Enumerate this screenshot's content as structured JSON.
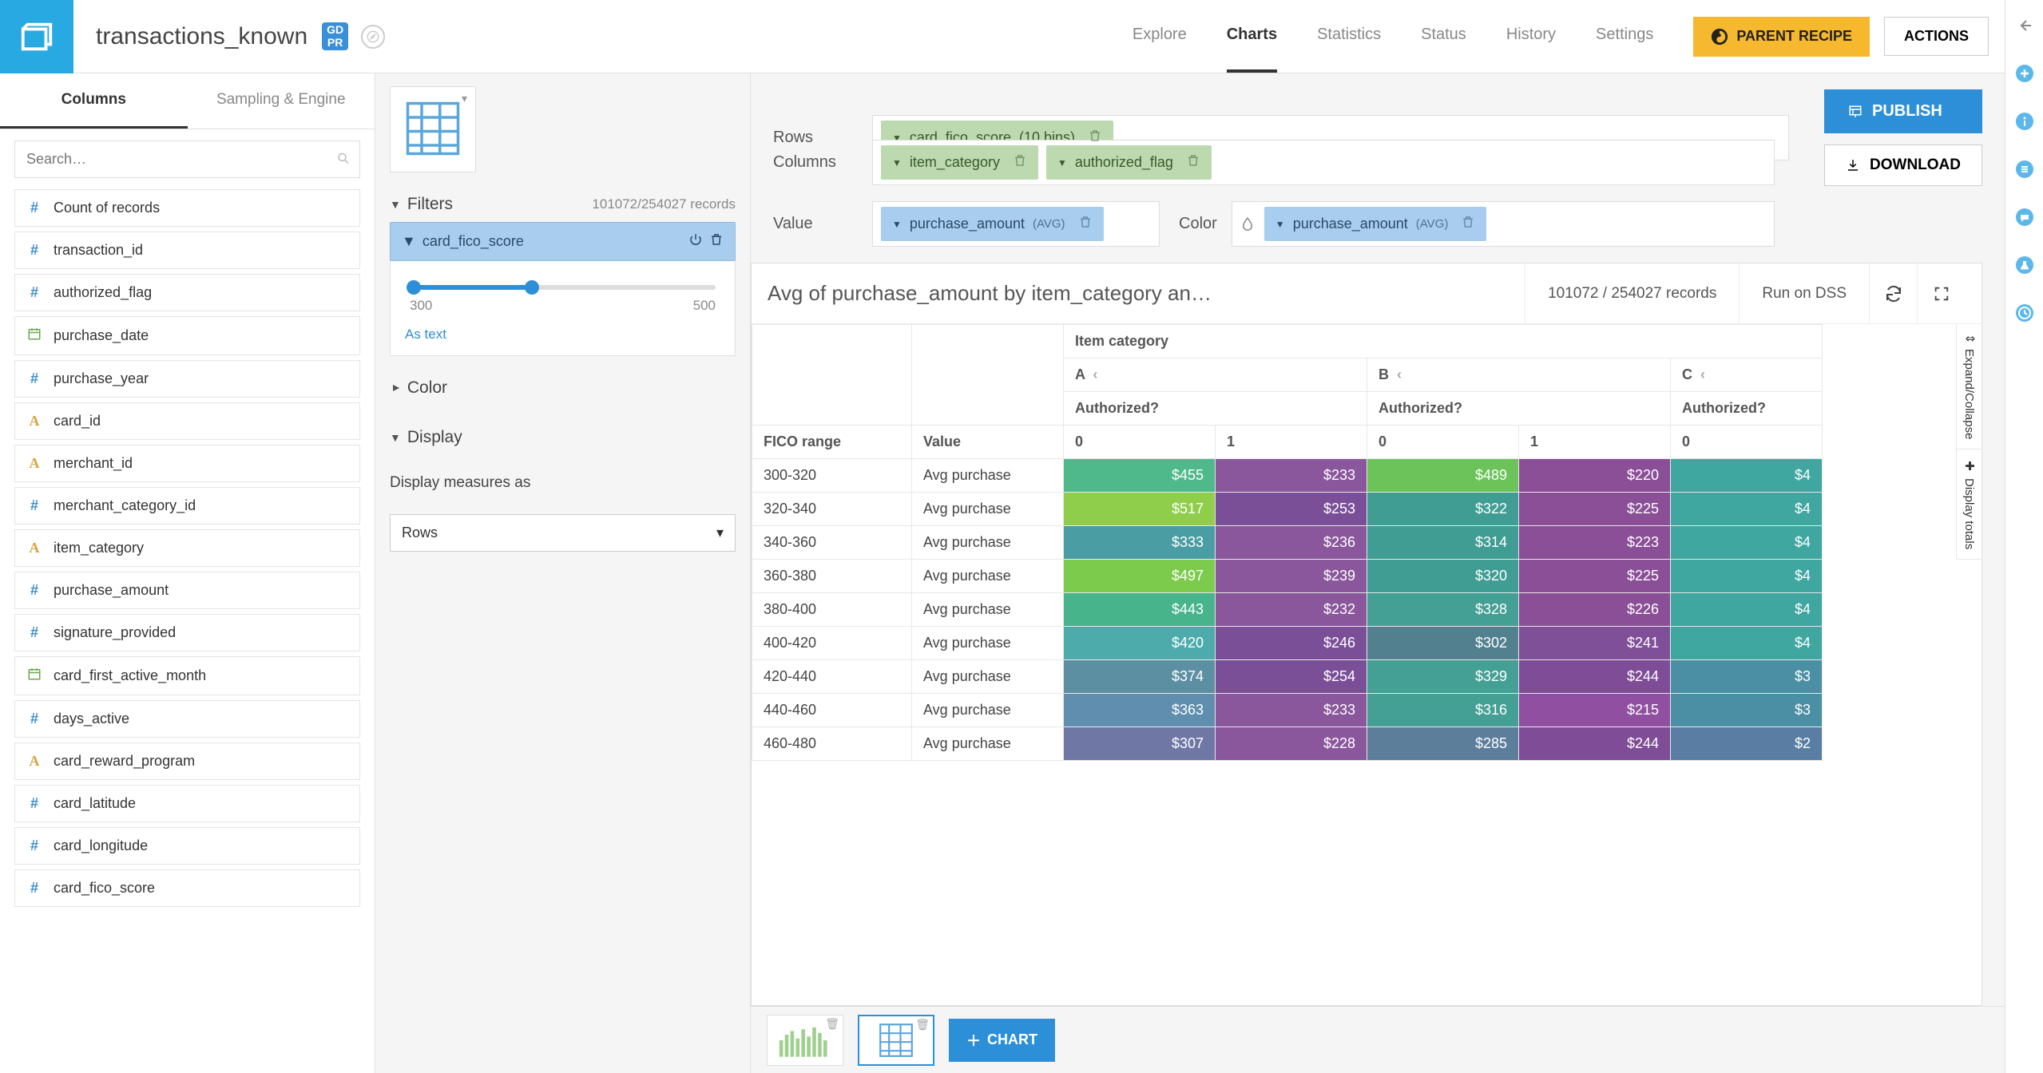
{
  "header": {
    "dataset_name": "transactions_known",
    "gdpr_badge": "GD\nPR",
    "tabs": [
      "Explore",
      "Charts",
      "Statistics",
      "Status",
      "History",
      "Settings"
    ],
    "active_tab": "Charts",
    "parent_recipe": "PARENT RECIPE",
    "actions": "ACTIONS"
  },
  "left_panel": {
    "tabs": [
      "Columns",
      "Sampling & Engine"
    ],
    "active": "Columns",
    "search_placeholder": "Search…",
    "columns": [
      {
        "icon": "num",
        "name": "Count of records"
      },
      {
        "icon": "num",
        "name": "transaction_id"
      },
      {
        "icon": "num",
        "name": "authorized_flag"
      },
      {
        "icon": "date",
        "name": "purchase_date"
      },
      {
        "icon": "num",
        "name": "purchase_year"
      },
      {
        "icon": "str",
        "name": "card_id"
      },
      {
        "icon": "str",
        "name": "merchant_id"
      },
      {
        "icon": "num",
        "name": "merchant_category_id"
      },
      {
        "icon": "str",
        "name": "item_category"
      },
      {
        "icon": "num",
        "name": "purchase_amount"
      },
      {
        "icon": "num",
        "name": "signature_provided"
      },
      {
        "icon": "date",
        "name": "card_first_active_month"
      },
      {
        "icon": "num",
        "name": "days_active"
      },
      {
        "icon": "str",
        "name": "card_reward_program"
      },
      {
        "icon": "num",
        "name": "card_latitude"
      },
      {
        "icon": "num",
        "name": "card_longitude"
      },
      {
        "icon": "num",
        "name": "card_fico_score"
      }
    ]
  },
  "mid_panel": {
    "filters_label": "Filters",
    "filters_records": "101072/254027 records",
    "filter_chip": "card_fico_score",
    "slider_min": "300",
    "slider_max": "500",
    "as_text": "As text",
    "color_label": "Color",
    "display_label": "Display",
    "display_measures": "Display measures as",
    "display_value": "Rows"
  },
  "config": {
    "rows_label": "Rows",
    "columns_label": "Columns",
    "value_label": "Value",
    "color_label": "Color",
    "row_chips": [
      {
        "text": "card_fico_score",
        "suffix": "(10 bins)"
      }
    ],
    "col_chips": [
      {
        "text": "item_category"
      },
      {
        "text": "authorized_flag"
      }
    ],
    "value_chips": [
      {
        "text": "purchase_amount",
        "agg": "(AVG)"
      }
    ],
    "color_chips": [
      {
        "text": "purchase_amount",
        "agg": "(AVG)"
      }
    ],
    "publish": "PUBLISH",
    "download": "DOWNLOAD"
  },
  "chart": {
    "title": "Avg of purchase_amount by item_category an…",
    "records": "101072 / 254027 records",
    "run_on": "Run on DSS",
    "side_expand": "Expand/Collapse",
    "side_totals": "Display totals",
    "header_item_category": "Item category",
    "header_fico": "FICO range",
    "header_value": "Value",
    "header_authorized": "Authorized?",
    "cat_labels": [
      "A",
      "B",
      "C"
    ],
    "auth_labels": [
      "0",
      "1",
      "0",
      "1",
      "0"
    ],
    "value_label_row": "Avg purchase"
  },
  "chart_data": {
    "type": "table",
    "row_dimension": "FICO range",
    "col_dimensions": [
      "Item category",
      "Authorized?"
    ],
    "measure": "Avg of purchase_amount",
    "columns_flat": [
      "A|0",
      "A|1",
      "B|0",
      "B|1",
      "C|0"
    ],
    "rows": [
      {
        "range": "300-320",
        "vals": [
          "$455",
          "$233",
          "$489",
          "$220",
          "$4"
        ],
        "colors": [
          "#4fb98b",
          "#8a569c",
          "#6cc35a",
          "#8a4f97",
          "#3fa6a0"
        ]
      },
      {
        "range": "320-340",
        "vals": [
          "$517",
          "$253",
          "$322",
          "$225",
          "$4"
        ],
        "colors": [
          "#8fce4a",
          "#7a4f97",
          "#3f9d93",
          "#8a4f97",
          "#3fa6a0"
        ]
      },
      {
        "range": "340-360",
        "vals": [
          "$333",
          "$236",
          "$314",
          "$223",
          "$4"
        ],
        "colors": [
          "#4a9ea3",
          "#8a569c",
          "#3f9d93",
          "#8a4f97",
          "#3fa6a0"
        ]
      },
      {
        "range": "360-380",
        "vals": [
          "$497",
          "$239",
          "$320",
          "$225",
          "$4"
        ],
        "colors": [
          "#7ccb4d",
          "#8a569c",
          "#3f9d93",
          "#8a4f97",
          "#3fa6a0"
        ]
      },
      {
        "range": "380-400",
        "vals": [
          "$443",
          "$232",
          "$328",
          "$226",
          "$4"
        ],
        "colors": [
          "#47b48c",
          "#8a569c",
          "#449f94",
          "#8a4f97",
          "#3fa6a0"
        ]
      },
      {
        "range": "400-420",
        "vals": [
          "$420",
          "$246",
          "$302",
          "$241",
          "$4"
        ],
        "colors": [
          "#4dacab",
          "#7a4f97",
          "#53808f",
          "#7f4f97",
          "#3fa6a0"
        ]
      },
      {
        "range": "420-440",
        "vals": [
          "$374",
          "$254",
          "$329",
          "$244",
          "$3"
        ],
        "colors": [
          "#5d8fa3",
          "#7a4f97",
          "#449f94",
          "#7f4d97",
          "#4a8fa3"
        ]
      },
      {
        "range": "440-460",
        "vals": [
          "$363",
          "$233",
          "$316",
          "$215",
          "$3"
        ],
        "colors": [
          "#5f8eae",
          "#8a569c",
          "#449f94",
          "#904fa0",
          "#4a8fa3"
        ]
      },
      {
        "range": "460-480",
        "vals": [
          "$307",
          "$228",
          "$285",
          "$244",
          "$2"
        ],
        "colors": [
          "#6f77a5",
          "#8a569c",
          "#5d7e9b",
          "#7f4d97",
          "#5a7ea3"
        ]
      }
    ]
  },
  "bottom": {
    "add_chart": "CHART"
  }
}
